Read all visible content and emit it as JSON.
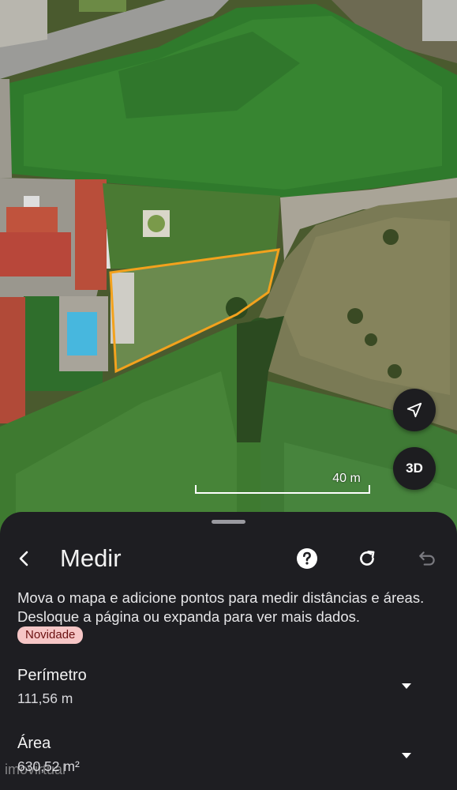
{
  "map": {
    "scale_label": "40 m",
    "button_3d_label": "3D",
    "measured_area_color": "#f3a21d"
  },
  "sheet": {
    "title": "Medir",
    "description": "Mova o mapa e adicione pontos para medir distâncias e áreas. Desloque a página ou expanda para ver mais dados.",
    "badge": "Novidade",
    "metrics": [
      {
        "label": "Perímetro",
        "value": "111,56 m"
      },
      {
        "label": "Área",
        "value": "630,52 m²"
      }
    ],
    "icons": {
      "back": "arrow-back-icon",
      "help": "help-circle-icon",
      "refresh": "refresh-icon",
      "undo": "undo-icon",
      "expand": "caret-down-icon",
      "locate": "navigation-arrow-icon"
    }
  },
  "watermark": "imovirtual"
}
